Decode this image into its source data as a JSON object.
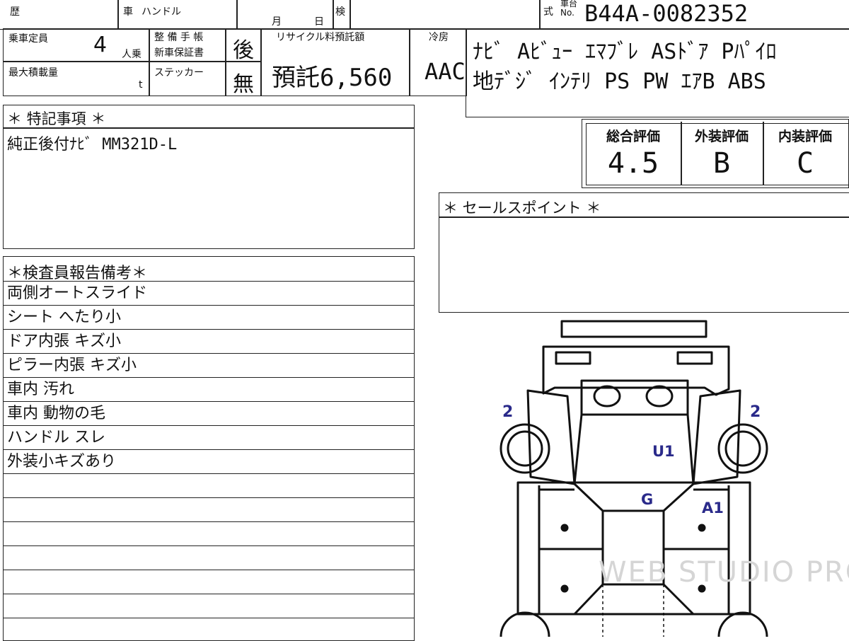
{
  "header": {
    "history_label": "歴",
    "vehicle_label": "車",
    "handle_label": "ハンドル",
    "month_label": "月",
    "day_label": "日",
    "inspection_label": "検",
    "model_label": "式",
    "chassis_label_line1": "車台",
    "chassis_label_line2": "No.",
    "chassis_number": "B44A-0082352"
  },
  "capacity": {
    "label": "乗車定員",
    "value": "4",
    "unit": "人乗"
  },
  "max_load": {
    "label": "最大積載量",
    "unit": "t"
  },
  "maintenance": {
    "label_line1": "整 備 手 帳",
    "label_line2": "新車保証書",
    "value": "後",
    "sticker_label": "ステッカー",
    "sticker_value": "無"
  },
  "recycle": {
    "label": "リサイクル料預託額",
    "value": "預託6,560"
  },
  "aircon": {
    "label": "冷房",
    "value": "AAC"
  },
  "equipment": {
    "line1": "ﾅﾋﾞ Aﾋﾞｭｰ ｴﾏﾌﾞﾚ ASﾄﾞｱ Pﾊﾟｲﾛ",
    "line2": "地ﾃﾞｼﾞ ｲﾝﾃﾘ PS PW ｴｱB ABS"
  },
  "special_notes": {
    "title": "＊ 特記事項 ＊",
    "text": "純正後付ﾅﾋﾞ MM321D-L"
  },
  "scores": {
    "overall_label": "総合評価",
    "overall_value": "4.5",
    "exterior_label": "外装評価",
    "exterior_value": "B",
    "interior_label": "内装評価",
    "interior_value": "C"
  },
  "sales_point": {
    "title": "＊ セールスポイント ＊"
  },
  "inspector": {
    "title": "＊検査員報告備考＊",
    "rows": [
      "両側オートスライド",
      "シート へたり小",
      "ドア内張 キズ小",
      "ピラー内張 キズ小",
      "車内 汚れ",
      "車内 動物の毛",
      "ハンドル スレ",
      "外装小キズあり",
      "",
      "",
      "",
      "",
      "",
      "",
      ""
    ]
  },
  "diagram": {
    "mark_left_front": "2",
    "mark_right_front": "2",
    "mark_roof": "U1",
    "mark_glass": "G",
    "mark_door": "A1",
    "mark_color": "#2a2a8a"
  },
  "watermark": "WEB STUDIO PRO"
}
